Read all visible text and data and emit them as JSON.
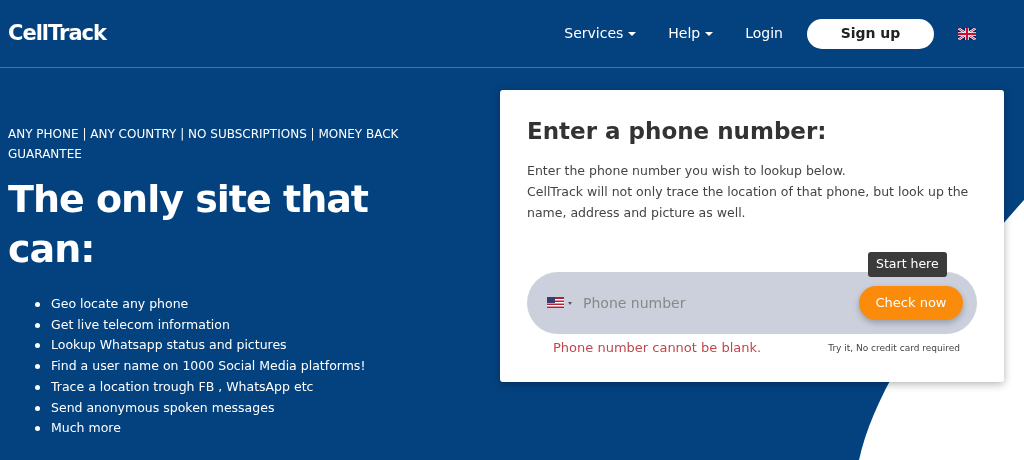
{
  "brand": "CellTrack",
  "nav": [
    {
      "label": "Services",
      "dropdown": true
    },
    {
      "label": "Help",
      "dropdown": true
    },
    {
      "label": "Login",
      "dropdown": false
    }
  ],
  "signup": "Sign up",
  "tagline": "ANY PHONE | ANY COUNTRY | NO SUBSCRIPTIONS | MONEY BACK GUARANTEE",
  "headline": "The only site that can:",
  "features": [
    "Geo locate any phone",
    "Get live telecom information",
    "Lookup Whatsapp status and pictures",
    "Find a user name on 1000 Social Media platforms!",
    "Trace a location trough FB , WhatsApp etc",
    "Send anonymous spoken messages",
    "Much more"
  ],
  "card": {
    "title": "Enter a phone number:",
    "intro": [
      "Enter the phone number you wish to lookup below.",
      "CellTrack will not only trace the location of that phone, but look up the name, address and picture as well."
    ],
    "phone": {
      "placeholder": "Phone number"
    },
    "tooltip": "Start here",
    "button": "Check now",
    "error": "Phone number cannot be blank.",
    "note": "Try it, No credit card required"
  }
}
